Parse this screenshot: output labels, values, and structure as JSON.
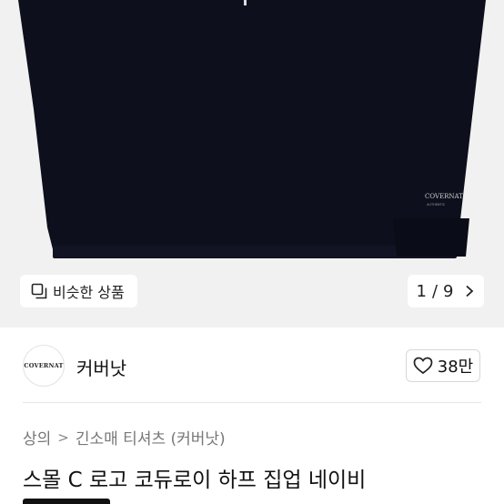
{
  "gallery": {
    "similar_label": "비슷한 상품",
    "similar_icon": "similar-items-icon",
    "page_current": "1",
    "page_separator": "/",
    "page_total": "9",
    "next_icon": "chevron-right-icon",
    "garment_logo_text": "COVERNAT",
    "garment_color": "#0d0f1c"
  },
  "store": {
    "logo_text": "COVERNAT",
    "name": "커버낫",
    "like_icon": "heart-icon",
    "like_count": "38만"
  },
  "breadcrumb": {
    "items": [
      "상의",
      "긴소매 티셔츠 (커버낫)"
    ],
    "separator": ">"
  },
  "product": {
    "title": "스몰 C 로고 코듀로이 하프 집업 네이비"
  }
}
